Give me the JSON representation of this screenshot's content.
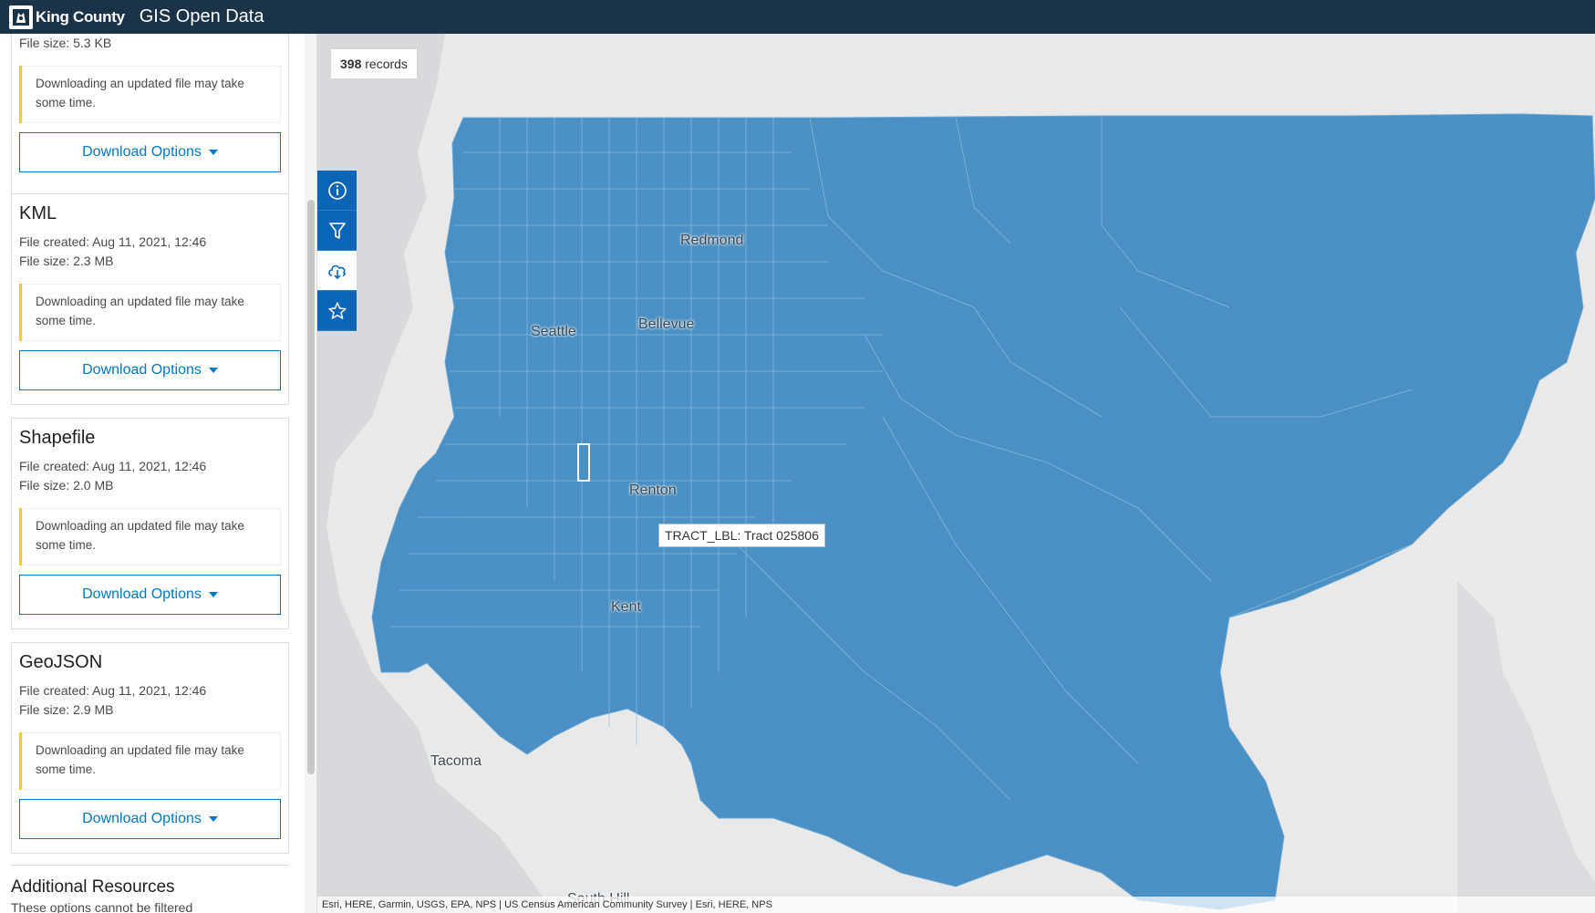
{
  "header": {
    "brand": "King County",
    "title": "GIS Open Data"
  },
  "sidebar": {
    "top_partial": {
      "file_size": "File size: 5.3 KB",
      "notice": "Downloading an updated file may take some time.",
      "button": "Download Options"
    },
    "formats": [
      {
        "name": "KML",
        "created": "File created: Aug 11, 2021, 12:46",
        "size": "File size: 2.3 MB",
        "notice": "Downloading an updated file may take some time.",
        "button": "Download Options"
      },
      {
        "name": "Shapefile",
        "created": "File created: Aug 11, 2021, 12:46",
        "size": "File size: 2.0 MB",
        "notice": "Downloading an updated file may take some time.",
        "button": "Download Options"
      },
      {
        "name": "GeoJSON",
        "created": "File created: Aug 11, 2021, 12:46",
        "size": "File size: 2.9 MB",
        "notice": "Downloading an updated file may take some time.",
        "button": "Download Options"
      }
    ],
    "additional": {
      "title": "Additional Resources",
      "subtitle": "These options cannot be filtered"
    }
  },
  "map": {
    "records_count": "398",
    "records_label": " records",
    "tools": [
      "info-icon",
      "filter-icon",
      "download-icon",
      "star-icon"
    ],
    "active_tool": "download-icon",
    "tooltip": "TRACT_LBL: Tract 025806",
    "cities": {
      "redmond": "Redmond",
      "seattle": "Seattle",
      "bellevue": "Bellevue",
      "renton": "Renton",
      "kent": "Kent",
      "tacoma": "Tacoma",
      "south_hill": "South Hill"
    },
    "attribution": "Esri, HERE, Garmin, USGS, EPA, NPS | US Census American Community Survey | Esri, HERE, NPS",
    "fill_color": "#4a90c4",
    "water_color": "#d9d9dc",
    "land_color": "#e9e9ea"
  }
}
